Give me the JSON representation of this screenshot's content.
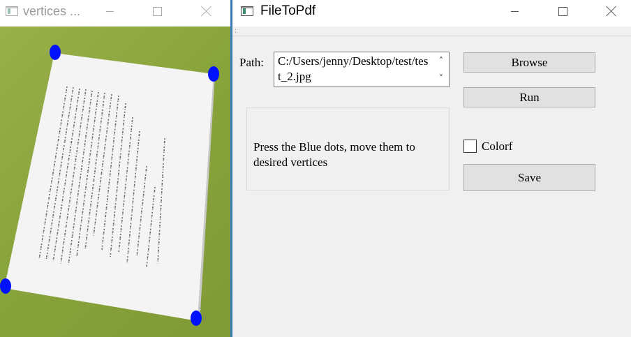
{
  "left_window": {
    "title": "vertices ..."
  },
  "right_window": {
    "title": "FileToPdf",
    "path_label": "Path:",
    "path_value": "C:/Users/jenny/Desktop/test/test_2.jpg",
    "browse_label": "Browse",
    "run_label": "Run",
    "info_text": "Press the Blue dots, move them to desired vertices",
    "color_label": "Colorf",
    "color_checked": false,
    "save_label": "Save"
  },
  "icons": {
    "minimize": "minimize-icon",
    "maximize": "maximize-icon",
    "close": "close-icon",
    "spin_up": "chevron-up-icon",
    "spin_down": "chevron-down-icon"
  },
  "colors": {
    "vertex_dot": "#0011ff",
    "table_green": "#8aa43c",
    "window_bg": "#f0f0f0",
    "button_bg": "#e1e1e1"
  }
}
